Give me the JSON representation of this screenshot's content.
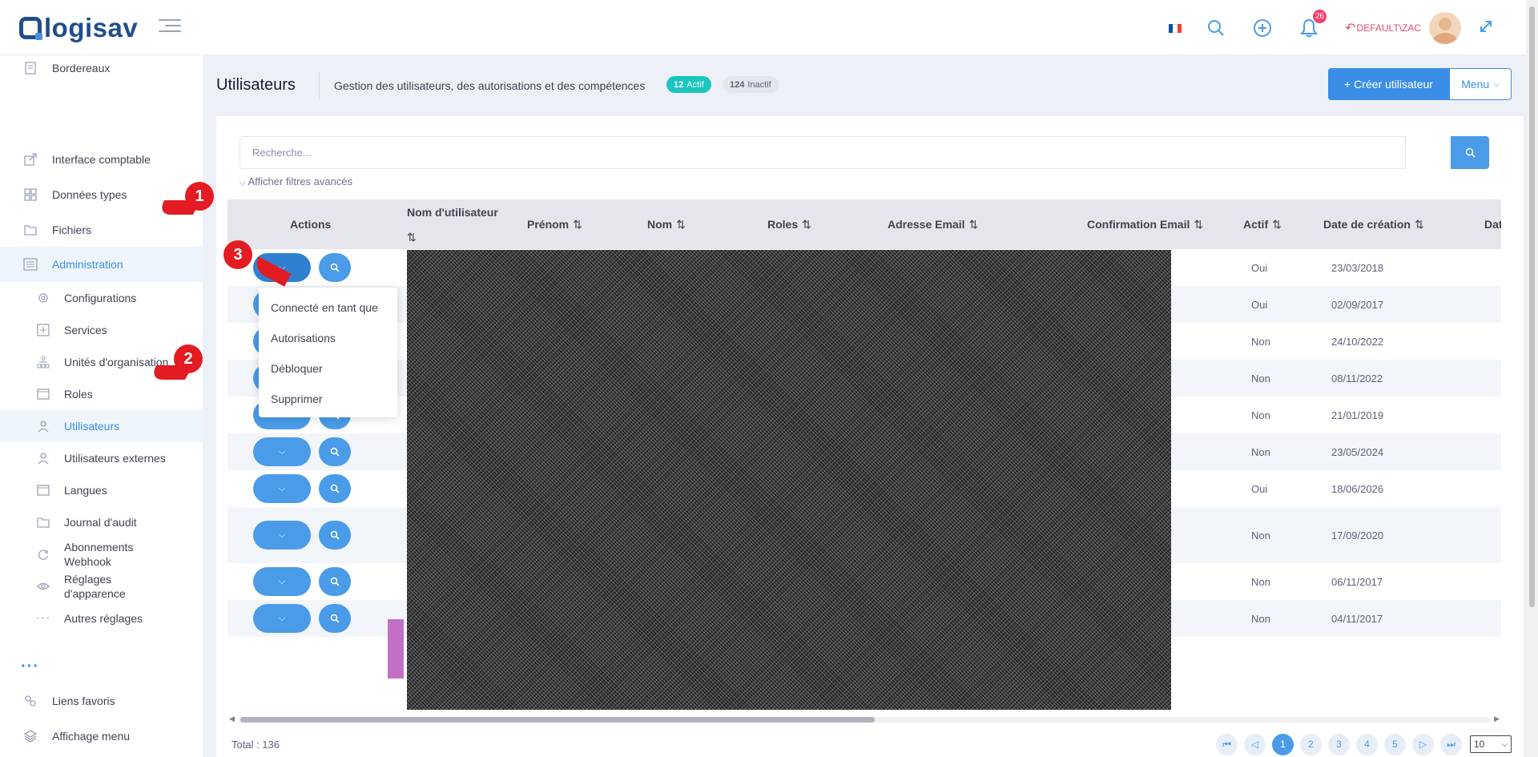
{
  "header": {
    "logo_text": "logisav",
    "notifications_count": "26",
    "user_context": "DEFAULT\\ZAC",
    "flag_colors": [
      "#0055a4",
      "#ffffff",
      "#ef4135"
    ]
  },
  "sidebar": {
    "items": [
      {
        "label": "Bordereaux",
        "icon": "document-icon"
      },
      {
        "label": "Interface comptable",
        "icon": "external-link-icon"
      },
      {
        "label": "Données types",
        "icon": "grid-icon"
      },
      {
        "label": "Fichiers",
        "icon": "folder-icon"
      },
      {
        "label": "Administration",
        "icon": "sliders-icon"
      }
    ],
    "sub_items": [
      {
        "label": "Configurations",
        "icon": "gear-icon"
      },
      {
        "label": "Services",
        "icon": "plus-box-icon"
      },
      {
        "label": "Unités d'organisation",
        "icon": "org-chart-icon"
      },
      {
        "label": "Roles",
        "icon": "window-icon"
      },
      {
        "label": "Utilisateurs",
        "icon": "user-icon"
      },
      {
        "label": "Utilisateurs externes",
        "icon": "user-icon"
      },
      {
        "label": "Langues",
        "icon": "window-icon"
      },
      {
        "label": "Journal d'audit",
        "icon": "folder-icon"
      },
      {
        "label": "Abonnements Webhook",
        "icon": "refresh-icon"
      },
      {
        "label": "Réglages d'apparence",
        "icon": "eye-icon"
      },
      {
        "label": "Autres réglages",
        "icon": "dots-icon"
      }
    ],
    "more": "···",
    "bottom_items": [
      {
        "label": "Liens favoris",
        "icon": "link-icon"
      },
      {
        "label": "Affichage menu",
        "icon": "layers-icon"
      }
    ],
    "markers": [
      "1",
      "2",
      "3"
    ]
  },
  "page": {
    "title": "Utilisateurs",
    "subtitle": "Gestion des utilisateurs, des autorisations et des compétences",
    "active_count": "12",
    "active_label": "Actif",
    "inactive_count": "124",
    "inactive_label": "Inactif",
    "create_button": "+ Créer utilisateur",
    "menu_button": "Menu"
  },
  "search": {
    "placeholder": "Recherche...",
    "advanced_filters": "Afficher filtres avancés"
  },
  "table": {
    "columns": [
      "Actions",
      "Nom d'utilisateur",
      "Prénom",
      "Nom",
      "Roles",
      "Adresse Email",
      "Confirmation Email",
      "Actif",
      "Date de création",
      "Dat"
    ],
    "sort_glyph": "⇅",
    "rows": [
      {
        "actif": "Oui",
        "date": "23/03/2018"
      },
      {
        "actif": "Oui",
        "date": "02/09/2017"
      },
      {
        "actif": "Non",
        "date": "24/10/2022"
      },
      {
        "actif": "Non",
        "date": "08/11/2022"
      },
      {
        "actif": "Non",
        "date": "21/01/2019"
      },
      {
        "actif": "Non",
        "date": "23/05/2024"
      },
      {
        "actif": "Oui",
        "date": "18/06/2026"
      },
      {
        "actif": "Non",
        "date": "17/09/2020"
      },
      {
        "actif": "Non",
        "date": "06/11/2017"
      },
      {
        "actif": "Non",
        "date": "04/11/2017"
      }
    ]
  },
  "dropdown": {
    "items": [
      "Connecté en tant que",
      "Autorisations",
      "Débloquer",
      "Supprimer"
    ]
  },
  "footer": {
    "total": "Total : 136",
    "pages": [
      "1",
      "2",
      "3",
      "4",
      "5"
    ],
    "current_page": "1",
    "page_size": "10"
  }
}
